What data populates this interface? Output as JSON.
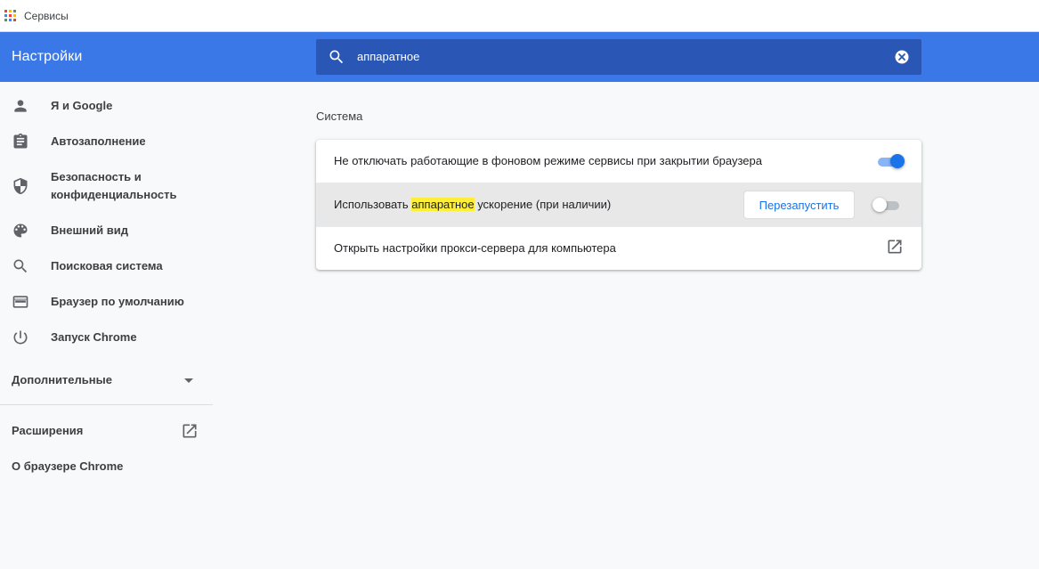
{
  "bookmarks_bar": {
    "apps_label": "Сервисы",
    "apps_icon": "apps-grid-icon",
    "apps_colors": [
      "#ea4335",
      "#fbbc04",
      "#34a853",
      "#4285f4",
      "#ea4335",
      "#fbbc04",
      "#34a853",
      "#4285f4",
      "#ea4335"
    ]
  },
  "header": {
    "title": "Настройки",
    "background": "#3b78e7",
    "search": {
      "value": "аппаратное",
      "icon": "search-icon",
      "clear_icon": "clear-icon"
    }
  },
  "sidebar": {
    "items": [
      {
        "label": "Я и Google",
        "icon": "person-icon"
      },
      {
        "label": "Автозаполнение",
        "icon": "clipboard-icon"
      },
      {
        "label": "Безопасность и конфиденциальность",
        "icon": "shield-icon"
      },
      {
        "label": "Внешний вид",
        "icon": "palette-icon"
      },
      {
        "label": "Поисковая система",
        "icon": "search-icon"
      },
      {
        "label": "Браузер по умолчанию",
        "icon": "browser-window-icon"
      },
      {
        "label": "Запуск Chrome",
        "icon": "power-icon"
      }
    ],
    "advanced": {
      "label": "Дополнительные",
      "icon": "chevron-down-icon"
    },
    "extensions": {
      "label": "Расширения",
      "icon": "open-in-new-icon"
    },
    "about": {
      "label": "О браузере Chrome"
    }
  },
  "main": {
    "section_title": "Система",
    "rows": [
      {
        "label": "Не отключать работающие в фоновом режиме сервисы при закрытии браузера",
        "toggle": true
      },
      {
        "label_before": "Использовать ",
        "label_highlight": "аппаратное",
        "label_after": " ускорение (при наличии)",
        "button_label": "Перезапустить",
        "toggle": false
      },
      {
        "label": "Открыть настройки прокси-сервера для компьютера",
        "icon": "open-in-new-icon"
      }
    ]
  },
  "colors": {
    "accent": "#1a73e8",
    "highlight": "#fdee3a"
  }
}
